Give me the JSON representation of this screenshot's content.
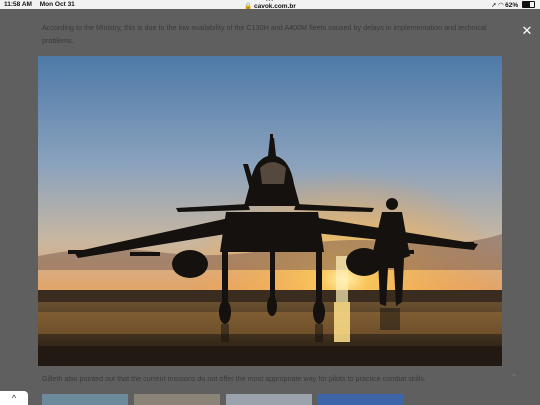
{
  "status_bar": {
    "time": "11:58 AM",
    "date": "Mon Oct 31",
    "url": "cavok.com.br",
    "battery": "62%",
    "battery_level": 0.62
  },
  "article": {
    "top_paragraph": "According to the Ministry, this is due to the low availability of the C130H and A400M fleets caused by delays in implementation and technical problems.",
    "bottom_paragraph": "Gilleth also pointed out that the current missions do not offer the most appropriate way for pilots to practice combat skills."
  },
  "lightbox": {
    "close_icon": "close-icon",
    "image_subject": "fighter-jet-silhouette-sunset"
  },
  "colors": {
    "overlay": "#5f5f5f",
    "status_bg": "#f2f2f2"
  }
}
